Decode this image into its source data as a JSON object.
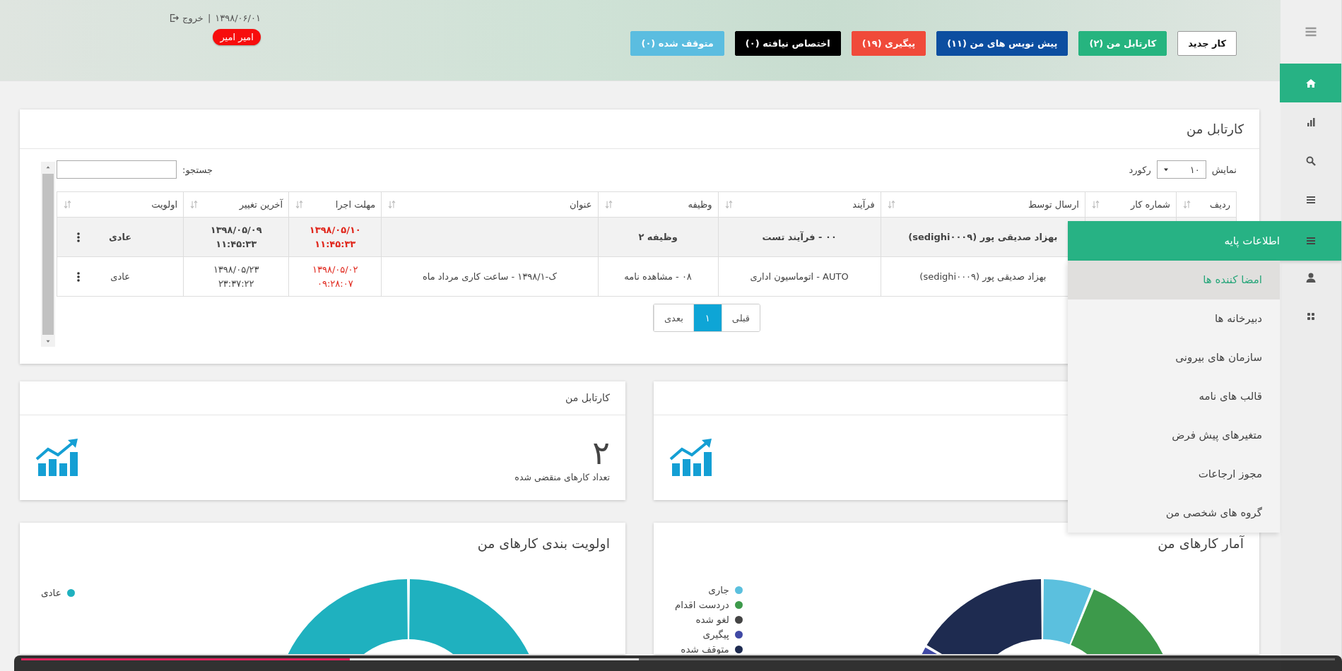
{
  "header": {
    "date": "۱۳۹۸/۰۶/۰۱",
    "separator": "|",
    "logout": "خروج",
    "user": "امیر امیر",
    "buttons": [
      {
        "label": "کار جدید",
        "color": "#ffffff"
      },
      {
        "label": "کارتابل من (۲)",
        "color": "#26b47f"
      },
      {
        "label": "پیش نویس های من (۱۱)",
        "color": "#0c4ea0"
      },
      {
        "label": "پیگیری (۱۹)",
        "color": "#f04a3a"
      },
      {
        "label": "اختصاص نیافته (۰)",
        "color": "#000000"
      },
      {
        "label": "متوقف شده (۰)",
        "color": "#5bbde0"
      }
    ]
  },
  "sidebar": {
    "items": [
      {
        "kind": "home",
        "selected": true,
        "expanded": false
      },
      {
        "kind": "chart",
        "selected": false,
        "expanded": false
      },
      {
        "kind": "search",
        "selected": false,
        "expanded": false
      },
      {
        "kind": "list",
        "selected": false,
        "expanded": false
      },
      {
        "kind": "list",
        "selected": false,
        "expanded": true,
        "title": "اطلاعات پایه",
        "children": [
          {
            "label": "امضا کننده ها",
            "selected": true
          },
          {
            "label": "دبیرخانه ها",
            "selected": false
          },
          {
            "label": "سازمان های بیرونی",
            "selected": false
          },
          {
            "label": "قالب های نامه",
            "selected": false
          },
          {
            "label": "متغیرهای پیش فرض",
            "selected": false
          },
          {
            "label": "مجوز ارجاعات",
            "selected": false
          },
          {
            "label": "گروه های شخصی من",
            "selected": false
          }
        ]
      },
      {
        "kind": "user",
        "selected": false,
        "expanded": false
      },
      {
        "kind": "grid",
        "selected": false,
        "expanded": false
      }
    ]
  },
  "kartabl": {
    "title": "کارتابل من",
    "show_label": "نمایش",
    "page_size": "۱۰",
    "records_label": "رکورد",
    "search_label": "جستجو:",
    "columns": [
      "ردیف",
      "شماره کار",
      "ارسال توسط",
      "فرآیند",
      "وظیفه",
      "عنوان",
      "مهلت اجرا",
      "آخرین تغییر",
      "اولویت"
    ],
    "rows": [
      {
        "selected": true,
        "sender": "بهزاد صدیقی پور (sedighi۰۰۰۹)",
        "process": "۰۰ - فرآیند تست",
        "task": "وظیفه ۲",
        "deadline": [
          "۱۳۹۸/۰۵/۱۰",
          "۱۱:۴۵:۳۳"
        ],
        "changed": [
          "۱۳۹۸/۰۵/۰۹",
          "۱۱:۴۵:۳۳"
        ],
        "priority": "عادی"
      },
      {
        "selected": false,
        "sender": "بهزاد صدیقی پور (sedighi۰۰۰۹)",
        "process": "AUTO - اتوماسیون اداری",
        "task": "۰۸ - مشاهده نامه",
        "title": "ک-۱۳۹۸/۱ - ساعت کاری مرداد ماه",
        "deadline": [
          "۱۳۹۸/۰۵/۰۲",
          "۰۹:۲۸:۰۷"
        ],
        "changed": [
          "۱۳۹۸/۰۵/۲۳",
          "۲۳:۳۷:۲۲"
        ],
        "priority": "عادی"
      }
    ],
    "pagination": {
      "prev": "قبلی",
      "next": "بعدی",
      "pages": [
        {
          "label": "۱",
          "selected": true
        }
      ]
    }
  },
  "stat_cards": [
    {
      "title": "کارتابل من",
      "value": "۲",
      "caption": "تعداد کارهای منقضی شده"
    }
  ],
  "video": {
    "level": 0.25
  },
  "charts": [
    {
      "title": "آمار کارهای من",
      "legend": [
        {
          "label": "جاری",
          "color": "#5bc0de"
        },
        {
          "label": "دردست اقدام",
          "color": "#3d9a4b"
        },
        {
          "label": "لغو شده",
          "color": "#444444"
        },
        {
          "label": "پیگیری",
          "color": "#4049a5"
        },
        {
          "label": "متوقف شده",
          "color": "#1e2b50"
        }
      ]
    },
    {
      "title": "اولویت بندی کارهای من",
      "legend": [
        {
          "label": "عادی",
          "color": "#1fb1bf"
        }
      ]
    }
  ]
}
